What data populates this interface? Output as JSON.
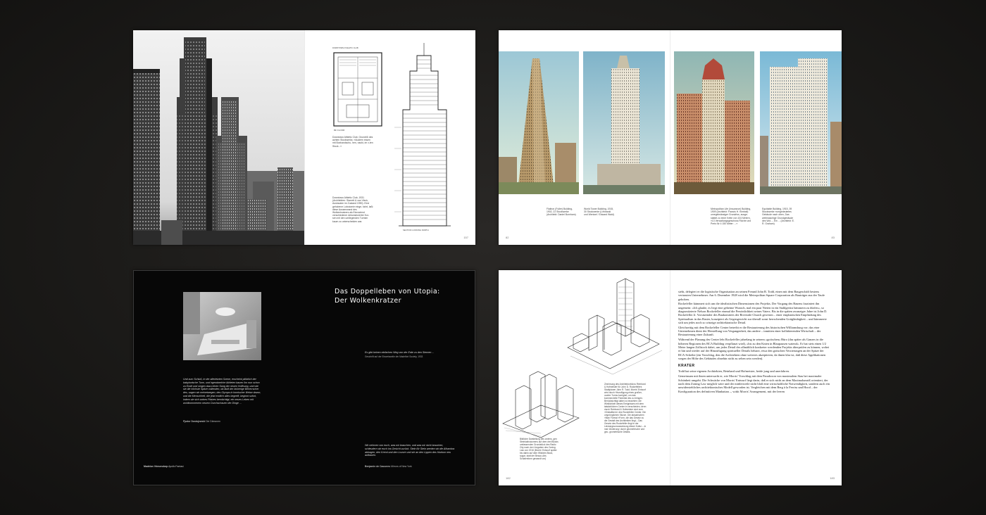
{
  "spread1": {
    "caption1": "Downtown Athletic Club, Grundriß des achten Stockwerks: »Austern essen mit Boxhandschu- hen, nackt, im x-ten Stock...«",
    "floor_label": "8th FLOOR",
    "plan_heading": "DOWNTOWN ATHLETIC CLUB",
    "section_label": "SECTION LOOKING NORTH",
    "caption2": "Downtown Athletic Club, 1931 (Architekten: Starrett & van Vleck, Ausbauten im Zustand 1990). Eine gehobene Lobotomie einge- fahrt, laßt diese Aussenwand des Wolkenkratzers als Einrostend verschiedener dekonstruierter Kur- sen mit den umliegenden Turmen kaum zu unterscheiden war.",
    "page_number": "157"
  },
  "spread2": {
    "caption_left_1": "Flatiron (Fuller) Building, 1902, 22 Stockwerke (Architekt: Daniel Burnham)",
    "caption_left_2": "World Tower Building, 1915, 30 Stockwerke (Lithowski und Wentzel / Edward Waid)",
    "caption_right_1": "Metropolitan Life (Insurance) Building, 1909 (Architekt: Francis H. Kimball) unregelmässiger Grundriss, ausge- stattet zu einer Kette von 104 Metern, »13 Verwaltungsgeschoss Fläche und Preis für 4 150 Meter: ...«",
    "caption_right_2": "Equitable Building, 1915, 39 Stockwerke »umgedeutetes Gebäude nach oben, Das weitmaschige Grundgebäude des Wol..., Ein ... (Architekt: E. R. Graham)",
    "page_left": "82",
    "page_right": "83"
  },
  "spread3": {
    "title_line1": "Das Doppelleben von Utopia:",
    "title_line2": "Der Wolkenkratzer",
    "quote1": "Es gibt keinen einfachen Weg von der Erde zu den Sternen ...",
    "quote1_source": "Geschrift auf der Einweiswelle der Madelfort Society, 1933",
    "quote2": "Und zum Schluß, in der allerletzten Szene, erscheint plötzlich der babylonische Turm, und irgendwelche Athleten bauen ihn nun schon zu Ende und singen dazu einen Sang der neuen Hoffnung, und wie sie die höchste Spitze vollenden, da läuft der bisherige Beherrscher des, sagen wir meinetwegen, des Olymps in komischer Weise davon, und die Menschheit, die jetzt endlich alles begreift, beginnt sofort, indem sie sich seines Platzes bemächtigt, ein neues Leben mit wohlkommenem neuem Durchschauen der Dinge ...",
    "quote2_source_name": "Fjodor Dostojewski",
    "quote2_source_title": "Die Dämonen",
    "quote3": "Wir nehmen von euch, was wir brauchen, und was wir nicht brauchen, schleudern wir euch ins Gesicht zurück. Stein für Stein werden wir die Alhambra abtragen, den Kreml und den Louvre und sie an den Lippen des Hudson neu aufbauen.",
    "quote3_source_name": "Benjamin de Casseres",
    "quote3_source_title": "Mirrors of New York",
    "bottom_left_name": "Madelon Vriesendorp",
    "bottom_left_title": "Apollo Fantasi"
  },
  "spread4": {
    "caption_plan": "Zeichnung des Architekturbüros Reinhard & Hofmeister für John D. Rockefellers Stadtplaner John R. Todd. Morris' Entwurf wird durch Hinzufügung eines großen, ovalen Turms korrigiert, um das kommerzielle Potential des zu bringen. Berücksichtigt dabei zu beachten: die Wirklichkeit dieses Ereignisses mit dem tatsächlichen Center in verschieden, denn durch Reinhard & Hofmeister sind zum »Kristallkern« des Rockefeller Center. Die ursprünglichen Skizze. Die aktuarischen »Man Formal »Form, die das Gesetz zu die Gestalt des Architekten liegt – Das Gesetz des Rockefeller liegt in der Leistungsvoraussetzung dieser Kultur – in mal ›Änderung‹ durch geometrische und geo- grometrische Details.",
    "caption_sketch": "Bildliche Darstellung des ordens- gen Steinkaltvolumens auf dem drei Blocks umfassenden Grundstück des Radio City nach den Vorgaben des Zoning Law von 1916 (Morris' Entwurf später bis dahin auf dem Wilshire-Block, sogar, statt der Beaux-Arts Schalenform gewandt vor)",
    "body_p1": "sieht, delegiert er die logistische Organisation an seinen Freund John R. Todd, einen mit dem Baugeschäft bestens vertrauten Unternehmer. Am 6. Dezember 1928 wird die Metropolitan Square Corporation als Bauträger aus der Taufe gehoben.",
    "body_p2": "Rockefeller kümmert sich um die idealistischen Dimensionen des Projekts. Der Vorgang des Bauens fasziniert ihn ungemein: »Ich glaube, es liegt eine geheime Wunsch, mal ein paar Nieten in ein Stahlgerüst hämmern zu dürfen«, so diagnostizierte Nelson Rockefeller einmal die Persönlichkeit seines Vaters. Bis in die späten zwanziger Jahre ist John D. Rockefeller Jr. Vorsitzender des Baukomitees der Riverside Church gewesen – einer emphatischen Empfindung des Spiritualism in das Raster, konzipiert als Gegengewicht zur überall sonst herrschenden Gottgläubigkeit – und kümmerte sich um jedes noch so winzige architektonische Detail.",
    "body_p3": "Gleichzeitig mit dem Rockefeller Center betreibt er die Restaurierung des historischen Williamsburg vor; das eine Unternehmen dient der Herstellung von Vergangenheit, das andere – inmitten einer kollabierenden Wirtschaft – der Restaurierung einer Zukunft.",
    "body_p4": "Während der Planung des Center lebt Rockefeller jahrelang in seinem »gotischen« Büro (das später als Ganzes in die höheren Regionen des RCA Building verpflanzt wird), »bis zu den Knien in Blaupausen watend«. Er hat stets einen 1/2 Meter langen Zollstock dabei, um jedes Detail des allmählich konkreter werdenden Projekts überprüfen zu können, wobei er hin und wieder auf der Hinzufügung spiritueller Details beharrt, etwa den gotischen Verzierungen an der Spitze der RCA-Scheibe (ein Vorschlag, den die Architekten ohne weiteres akzeptieren, da ihnen klar ist, daß diese Applikationen wegen der Höhe des Gebäudes ohnehin nicht zu sehen sein werden).",
    "krater_heading": "KRATER",
    "body_p5": "Todd hat seine eigenen Architekten, Reinhard und Hofmeister, beide jung und unerfahren.",
    "body_p6": "Gemeinsam mit ihnen untersucht er, wie Morris' Vorschlag mit dem Paradoxon von maximalem Stau bei maximaler Schönheit umgeht. Die Schwäche von Morris' Entwurf liegt darin, daß er sich nicht an dem Maximalumriß orientiert, der nach dem Zoning Law möglich wäre und der mittlerweile nicht bloß eine wirtschaftliche Notwendigkeit, sondern auch ein unwiderstehliches architektonisches Modell geworden ist. Vergleichen mit dem Berg à la Ferriss und Hood – der Konfiguration des definitiven Manhattan –, wirkt Morris' Arrangement, mit der leeren",
    "page_left": "182",
    "page_right": "183"
  }
}
